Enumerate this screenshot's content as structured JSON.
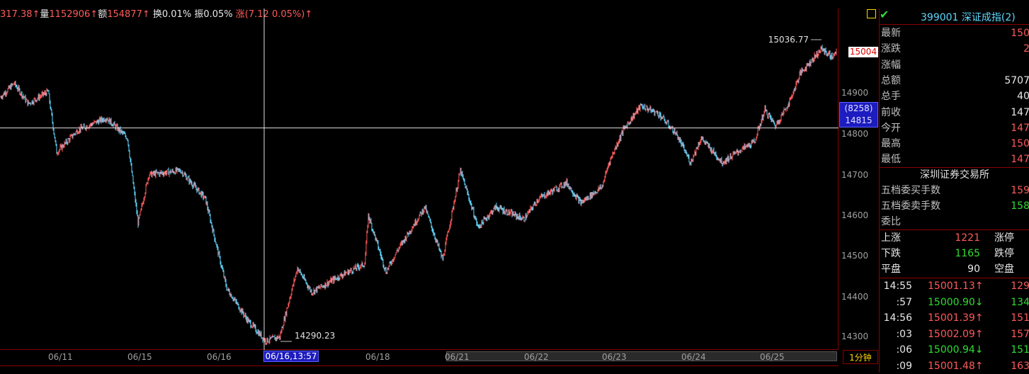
{
  "infobar": {
    "amount_frag": "317.38↑",
    "vol_label": "量",
    "vol_value": "1152906↑",
    "amt_label": "额",
    "amt_value": "154877↑",
    "turnover": "换0.01%",
    "amplitude": "振0.05%",
    "change": "涨(7.12",
    "change_pct": "0.05%)↑"
  },
  "price_axis": {
    "labels": [
      "14900",
      "14800",
      "14700",
      "14600",
      "14500",
      "14400",
      "14300"
    ],
    "current_price": "15004",
    "crosshair_qty": "(8258)",
    "crosshair_price": "14815"
  },
  "annotations": {
    "high": "15036.77",
    "low": "14290.23"
  },
  "x_axis": {
    "labels": [
      "06/11",
      "06/15",
      "06/16",
      "06/18",
      "06/21",
      "06/22",
      "06/23",
      "06/24",
      "06/25"
    ],
    "crosshair": "06/16,13:57",
    "period": "1分钟"
  },
  "panel": {
    "code": "399001",
    "name": "深证成指(2)",
    "quote": [
      {
        "k": "最新",
        "v": "150",
        "c": "#ff5a5a"
      },
      {
        "k": "涨跌",
        "v": "2",
        "c": "#ff5a5a"
      },
      {
        "k": "涨幅",
        "v": "",
        "c": "#ff5a5a"
      },
      {
        "k": "总额",
        "v": "5707",
        "c": "#e8e8e8"
      },
      {
        "k": "总手",
        "v": "40",
        "c": "#e8e8e8"
      },
      {
        "k": "前收",
        "v": "147",
        "c": "#e8e8e8"
      },
      {
        "k": "今开",
        "v": "147",
        "c": "#ff5a5a"
      },
      {
        "k": "最高",
        "v": "150",
        "c": "#ff5a5a"
      },
      {
        "k": "最低",
        "v": "147",
        "c": "#ff5a5a"
      }
    ],
    "exchange": "深圳证券交易所",
    "orders": [
      {
        "k": "五档委买手数",
        "v": "159",
        "c": "#ff5a5a"
      },
      {
        "k": "五档委卖手数",
        "v": "158",
        "c": "#32dc32"
      },
      {
        "k": "委比",
        "v": "",
        "c": "#e8e8e8"
      }
    ],
    "breadth": [
      {
        "k": "上涨",
        "v": "1221",
        "c": "#ff5a5a",
        "k2": "涨停"
      },
      {
        "k": "下跌",
        "v": "1165",
        "c": "#32dc32",
        "k2": "跌停"
      },
      {
        "k": "平盘",
        "v": "90",
        "c": "#e8e8e8",
        "k2": "空盘"
      }
    ],
    "ticks": [
      {
        "t": "14:55",
        "p": "15001.13↑",
        "v": "129",
        "c": "#ff5a5a"
      },
      {
        "t": ":57",
        "p": "15000.90↓",
        "v": "134",
        "c": "#32dc32"
      },
      {
        "t": "14:56",
        "p": "15001.39↑",
        "v": "151",
        "c": "#ff5a5a"
      },
      {
        "t": ":03",
        "p": "15002.09↑",
        "v": "157",
        "c": "#ff5a5a"
      },
      {
        "t": ":06",
        "p": "15000.94↓",
        "v": "151",
        "c": "#32dc32"
      },
      {
        "t": ":09",
        "p": "15001.48↑",
        "v": "163",
        "c": "#ff5a5a"
      }
    ]
  },
  "colors": {
    "up": "#ff5a5a",
    "down": "#5fd7ff",
    "frame": "#8a0000"
  }
}
